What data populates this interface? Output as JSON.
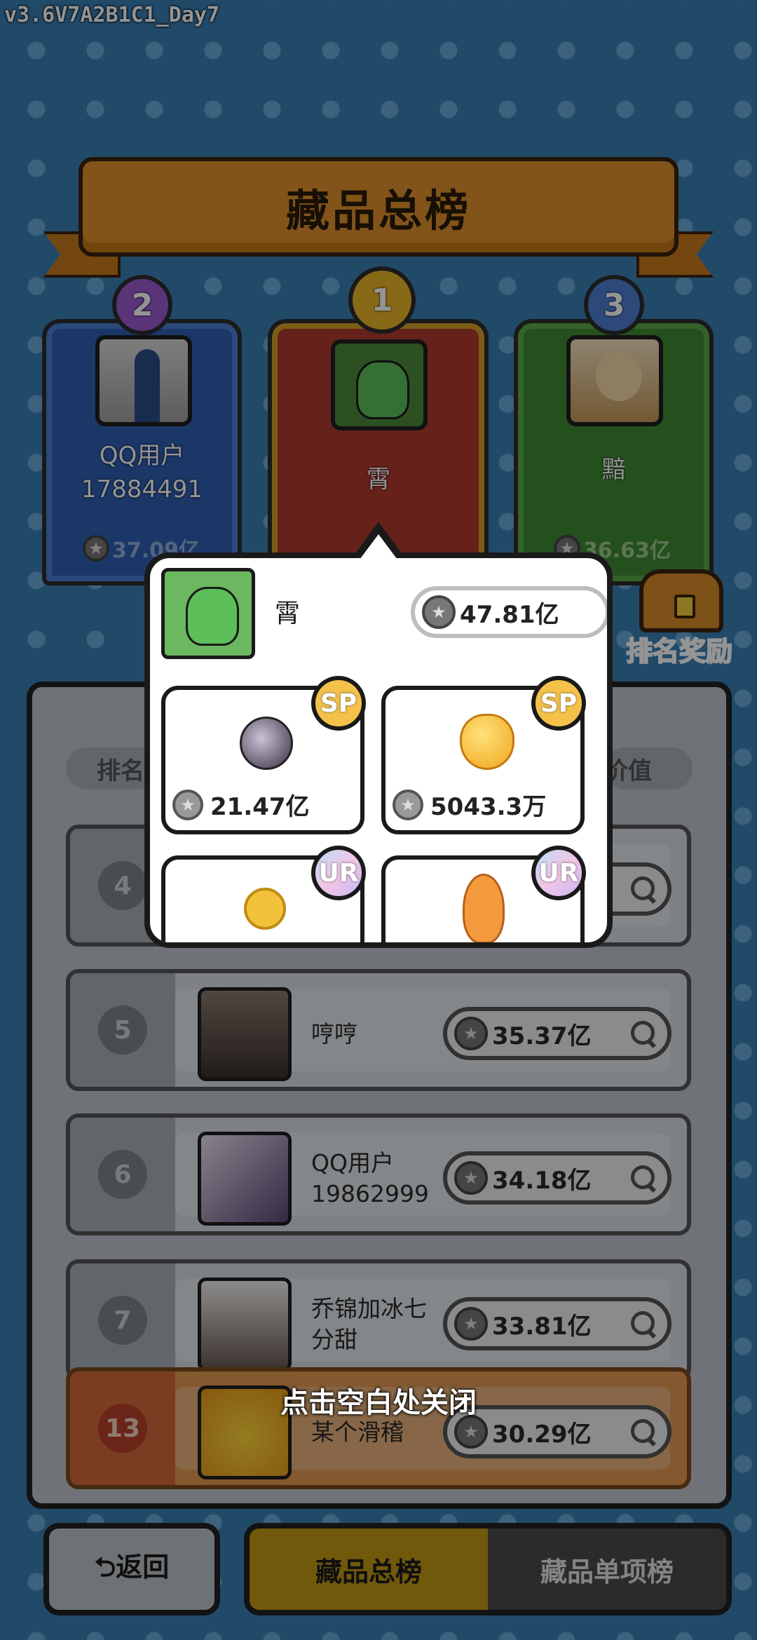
{
  "version": "v3.6V7A2B1C1_Day7",
  "title": "藏品总榜",
  "podium": [
    {
      "rank": "2",
      "name": "QQ用户\n17884491",
      "value": "37.09亿"
    },
    {
      "rank": "1",
      "name": "霄",
      "value": ""
    },
    {
      "rank": "3",
      "name": "黯",
      "value": "36.63亿"
    }
  ],
  "reward_label": "排名奖励",
  "headers": {
    "rank": "排名",
    "value": "价值"
  },
  "rows": [
    {
      "rank": "4",
      "name": "",
      "value": ""
    },
    {
      "rank": "5",
      "name": "哼哼",
      "value": "35.37亿"
    },
    {
      "rank": "6",
      "name": "QQ用户\n19862999",
      "value": "34.18亿"
    },
    {
      "rank": "7",
      "name": "乔锦加冰七\n分甜",
      "value": "33.81亿"
    }
  ],
  "my_row": {
    "rank": "13",
    "name": "某个滑稽",
    "value": "30.29亿"
  },
  "popup": {
    "name": "霄",
    "total": "47.81亿",
    "items": [
      {
        "tier": "SP",
        "value": "21.47亿",
        "icon": "orb-icon"
      },
      {
        "tier": "SP",
        "value": "5043.3万",
        "icon": "golden-apple-icon"
      },
      {
        "tier": "UR",
        "value": "",
        "icon": "medal-icon"
      },
      {
        "tier": "UR",
        "value": "",
        "icon": "koi-fish-icon"
      }
    ]
  },
  "close_hint": "点击空白处关闭",
  "bottom": {
    "back": "⮌返回",
    "tab_total": "藏品总榜",
    "tab_single": "藏品单项榜"
  },
  "colors": {
    "background": "#3a80b6",
    "rank1": "#b03a30",
    "rank2": "#2f5fb4",
    "rank3": "#3f8a34",
    "active_tab": "#c39a14"
  }
}
